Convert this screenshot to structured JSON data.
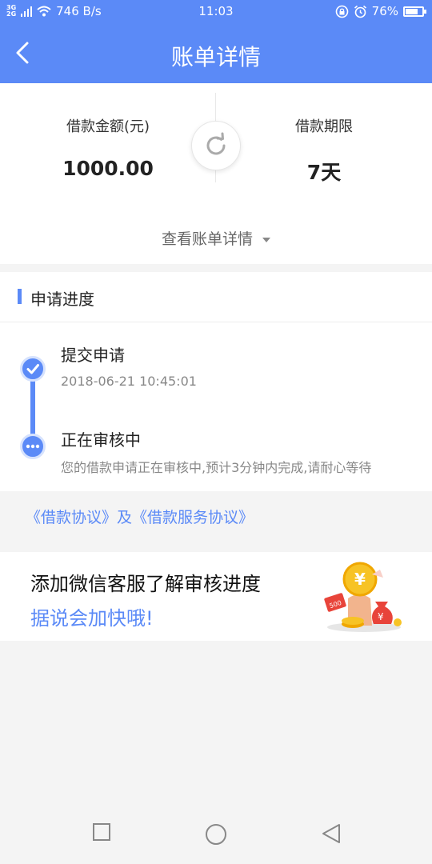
{
  "status_bar": {
    "network": [
      "3G",
      "2G"
    ],
    "speed": "746 B/s",
    "time": "11:03",
    "battery_percent": "76%",
    "battery_level": 0.76
  },
  "navbar": {
    "title": "账单详情",
    "back_icon": "chevron-left-icon"
  },
  "loan": {
    "amount_label": "借款金额(元)",
    "amount_value": "1000.00",
    "term_label": "借款期限",
    "term_value": "7天",
    "view_details": "查看账单详情"
  },
  "progress": {
    "header": "申请进度",
    "steps": [
      {
        "title": "提交申请",
        "subtitle": "2018-06-21 10:45:01",
        "icon": "check-icon"
      },
      {
        "title": "正在审核中",
        "subtitle": "您的借款申请正在审核中,预计3分钟内完成,请耐心等待",
        "icon": "more-dots-icon"
      }
    ]
  },
  "agreements": "《借款协议》及《借款服务协议》",
  "wechat": {
    "line1": "添加微信客服了解审核进度",
    "line2": "据说会加快哦!",
    "coin_symbol": "¥",
    "tag_text": "500"
  },
  "colors": {
    "brand": "#5b8af7",
    "background": "#f4f4f4",
    "gold": "#f7c325",
    "red": "#e8443a"
  }
}
